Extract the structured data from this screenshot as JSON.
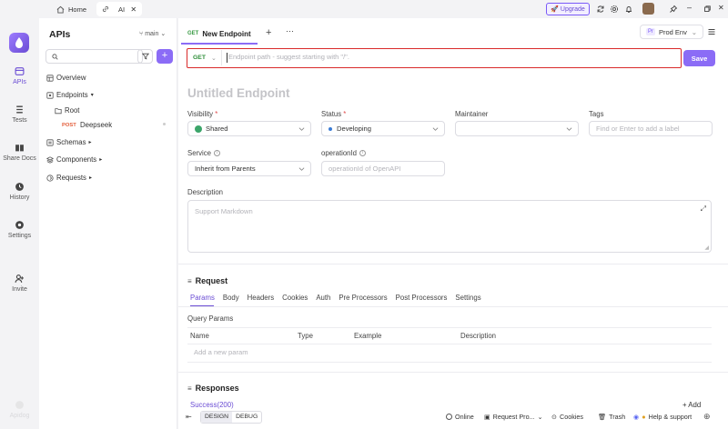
{
  "titlebar": {
    "tabs": [
      {
        "label": "Home"
      },
      {
        "label": "AI"
      }
    ],
    "upgrade_label": "Upgrade"
  },
  "rail": {
    "items": [
      {
        "label": "APIs",
        "icon": "apis-icon"
      },
      {
        "label": "Tests",
        "icon": "tests-icon"
      },
      {
        "label": "Share Docs",
        "icon": "share-docs-icon"
      },
      {
        "label": "History",
        "icon": "history-icon"
      },
      {
        "label": "Settings",
        "icon": "settings-icon"
      },
      {
        "label": "Invite",
        "icon": "invite-icon"
      },
      {
        "label": "Apidog",
        "icon": "apidog-icon"
      }
    ]
  },
  "sidebar": {
    "title": "APIs",
    "branch": "main",
    "search_placeholder": "",
    "tree": {
      "overview": "Overview",
      "endpoints": "Endpoints",
      "root": "Root",
      "endpoint_method": "POST",
      "endpoint_name": "Deepseek",
      "schemas": "Schemas",
      "components": "Components",
      "requests": "Requests"
    }
  },
  "main": {
    "tab": {
      "method": "GET",
      "label": "New Endpoint"
    },
    "environment": {
      "badge": "Pr",
      "label": "Prod Env"
    },
    "url": {
      "method": "GET",
      "placeholder": "Endpoint path - suggest starting with \"/\"."
    },
    "save_label": "Save",
    "title_placeholder": "Untitled Endpoint",
    "fields": {
      "visibility_label": "Visibility",
      "visibility_value": "Shared",
      "status_label": "Status",
      "status_value": "Developing",
      "maintainer_label": "Maintainer",
      "tags_label": "Tags",
      "tags_placeholder": "Find or Enter to add a label",
      "service_label": "Service",
      "service_value": "Inherit from Parents",
      "operation_label": "operationId",
      "operation_placeholder": "operationId of OpenAPI",
      "description_label": "Description",
      "description_placeholder": "Support Markdown"
    },
    "request": {
      "heading": "Request",
      "tabs": [
        "Params",
        "Body",
        "Headers",
        "Cookies",
        "Auth",
        "Pre Processors",
        "Post Processors",
        "Settings"
      ],
      "query_label": "Query Params",
      "columns": [
        "Name",
        "Type",
        "Example",
        "Description"
      ],
      "add_param_placeholder": "Add a new param"
    },
    "responses": {
      "heading": "Responses",
      "success_label": "Success(200)",
      "add_label": "+ Add"
    }
  },
  "bottombar": {
    "design": "DESIGN",
    "debug": "DEBUG",
    "online": "Online",
    "request_proxy": "Request Pro...",
    "cookies": "Cookies",
    "trash": "Trash",
    "help": "Help & support"
  },
  "colors": {
    "accent": "#8b6cf6",
    "get": "#2f8f3a",
    "post": "#e35d3a",
    "highlight": "#d92a2a"
  }
}
